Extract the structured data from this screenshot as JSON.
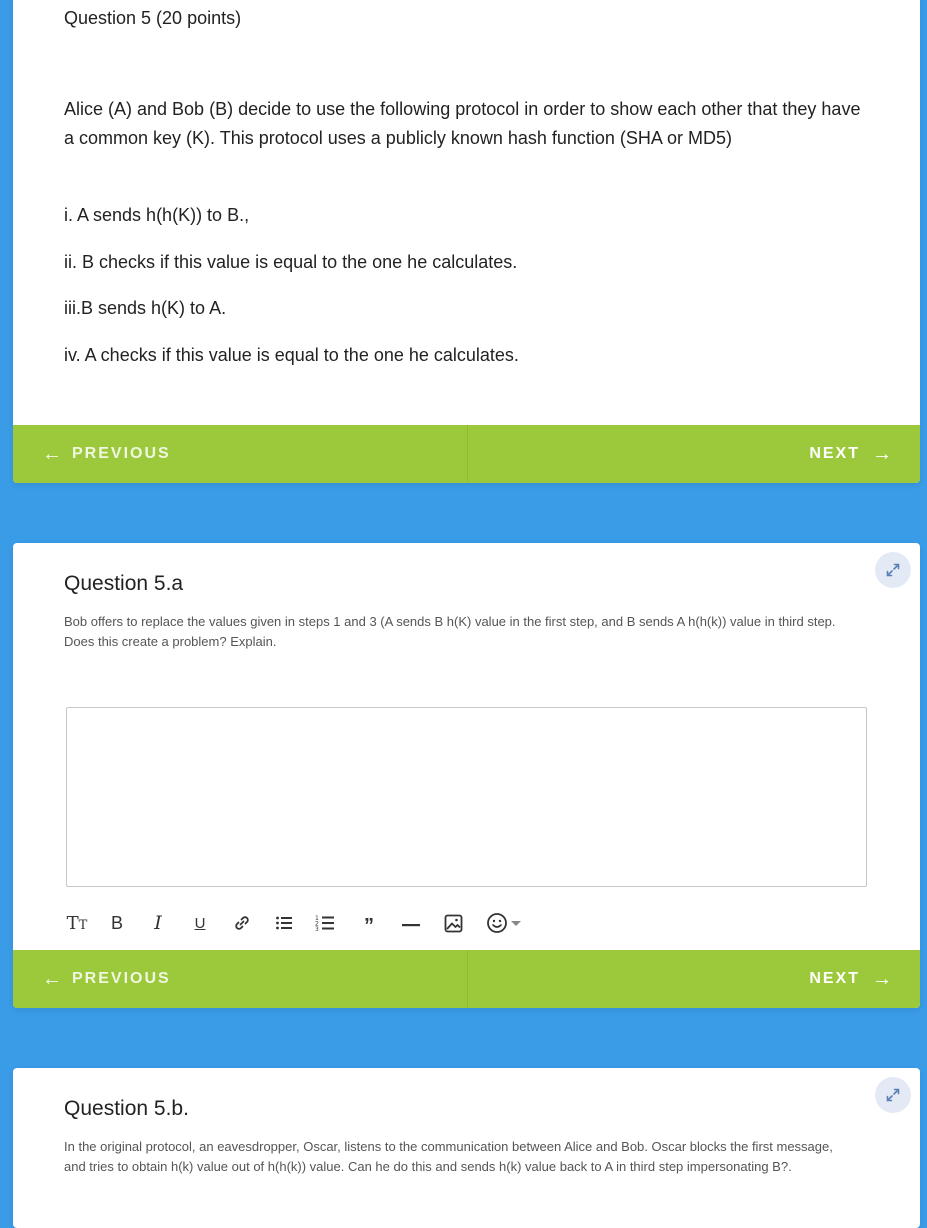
{
  "card1": {
    "header": "Question 5 (20 points)",
    "intro": "Alice (A) and Bob (B) decide to use the following protocol in order to show each other that they have a common key (K). This protocol uses a publicly known hash function (SHA or MD5)",
    "steps": [
      "i. A sends  h(h(K)) to B.,",
      "ii. B checks if this value is equal to the one he calculates.",
      "iii.B sends h(K) to A.",
      "iv. A checks if this value is equal to the one he calculates."
    ]
  },
  "nav": {
    "previous_label": "PREVIOUS",
    "next_label": "NEXT"
  },
  "question_a": {
    "title": "Question 5.a",
    "description": "Bob offers to replace the values given in steps 1 and 3  (A sends B h(K) value in the first step, and B sends A h(h(k)) value in third step. Does this create a problem? Explain.",
    "answer_value": ""
  },
  "question_b": {
    "title": "Question 5.b.",
    "description": "In the original protocol, an eavesdropper, Oscar, listens to the communication between Alice and Bob. Oscar blocks the first message, and tries to obtain h(k) value out of h(h(k)) value. Can he do this and sends h(k) value back to A in third step impersonating B?."
  },
  "toolbar": {
    "buttons": [
      "text-size-icon",
      "bold-icon",
      "italic-icon",
      "underline-icon",
      "link-icon",
      "bulleted-list-icon",
      "numbered-list-icon",
      "quote-icon",
      "horizontal-rule-icon",
      "image-icon",
      "emoji-icon"
    ]
  },
  "colors": {
    "background": "#3a9be6",
    "nav_bar": "#9cc93b",
    "expand_button": "#e3eaf6"
  }
}
